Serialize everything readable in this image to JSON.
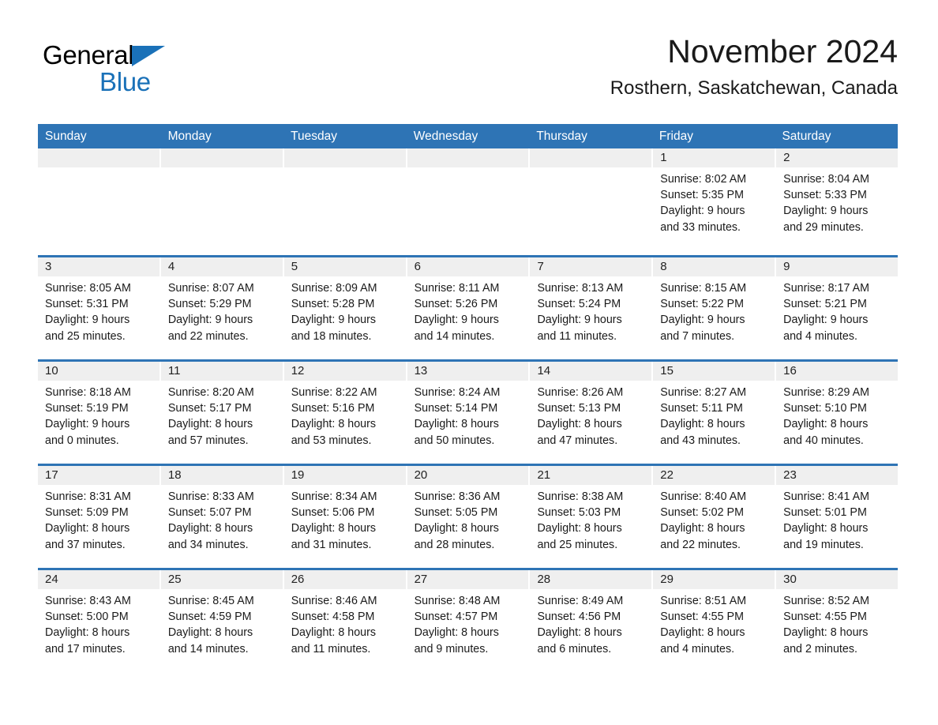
{
  "brand": {
    "name_part1": "General",
    "name_part2": "Blue"
  },
  "header": {
    "month_title": "November 2024",
    "location": "Rosthern, Saskatchewan, Canada"
  },
  "colors": {
    "header_blue": "#2e74b5",
    "logo_blue": "#1a71b8",
    "day_band_gray": "#efefef"
  },
  "calendar": {
    "weekdays": [
      "Sunday",
      "Monday",
      "Tuesday",
      "Wednesday",
      "Thursday",
      "Friday",
      "Saturday"
    ],
    "weeks": [
      [
        {
          "day": "",
          "empty": true
        },
        {
          "day": "",
          "empty": true
        },
        {
          "day": "",
          "empty": true
        },
        {
          "day": "",
          "empty": true
        },
        {
          "day": "",
          "empty": true
        },
        {
          "day": "1",
          "sunrise": "Sunrise: 8:02 AM",
          "sunset": "Sunset: 5:35 PM",
          "daylight_line1": "Daylight: 9 hours",
          "daylight_line2": "and 33 minutes."
        },
        {
          "day": "2",
          "sunrise": "Sunrise: 8:04 AM",
          "sunset": "Sunset: 5:33 PM",
          "daylight_line1": "Daylight: 9 hours",
          "daylight_line2": "and 29 minutes."
        }
      ],
      [
        {
          "day": "3",
          "sunrise": "Sunrise: 8:05 AM",
          "sunset": "Sunset: 5:31 PM",
          "daylight_line1": "Daylight: 9 hours",
          "daylight_line2": "and 25 minutes."
        },
        {
          "day": "4",
          "sunrise": "Sunrise: 8:07 AM",
          "sunset": "Sunset: 5:29 PM",
          "daylight_line1": "Daylight: 9 hours",
          "daylight_line2": "and 22 minutes."
        },
        {
          "day": "5",
          "sunrise": "Sunrise: 8:09 AM",
          "sunset": "Sunset: 5:28 PM",
          "daylight_line1": "Daylight: 9 hours",
          "daylight_line2": "and 18 minutes."
        },
        {
          "day": "6",
          "sunrise": "Sunrise: 8:11 AM",
          "sunset": "Sunset: 5:26 PM",
          "daylight_line1": "Daylight: 9 hours",
          "daylight_line2": "and 14 minutes."
        },
        {
          "day": "7",
          "sunrise": "Sunrise: 8:13 AM",
          "sunset": "Sunset: 5:24 PM",
          "daylight_line1": "Daylight: 9 hours",
          "daylight_line2": "and 11 minutes."
        },
        {
          "day": "8",
          "sunrise": "Sunrise: 8:15 AM",
          "sunset": "Sunset: 5:22 PM",
          "daylight_line1": "Daylight: 9 hours",
          "daylight_line2": "and 7 minutes."
        },
        {
          "day": "9",
          "sunrise": "Sunrise: 8:17 AM",
          "sunset": "Sunset: 5:21 PM",
          "daylight_line1": "Daylight: 9 hours",
          "daylight_line2": "and 4 minutes."
        }
      ],
      [
        {
          "day": "10",
          "sunrise": "Sunrise: 8:18 AM",
          "sunset": "Sunset: 5:19 PM",
          "daylight_line1": "Daylight: 9 hours",
          "daylight_line2": "and 0 minutes."
        },
        {
          "day": "11",
          "sunrise": "Sunrise: 8:20 AM",
          "sunset": "Sunset: 5:17 PM",
          "daylight_line1": "Daylight: 8 hours",
          "daylight_line2": "and 57 minutes."
        },
        {
          "day": "12",
          "sunrise": "Sunrise: 8:22 AM",
          "sunset": "Sunset: 5:16 PM",
          "daylight_line1": "Daylight: 8 hours",
          "daylight_line2": "and 53 minutes."
        },
        {
          "day": "13",
          "sunrise": "Sunrise: 8:24 AM",
          "sunset": "Sunset: 5:14 PM",
          "daylight_line1": "Daylight: 8 hours",
          "daylight_line2": "and 50 minutes."
        },
        {
          "day": "14",
          "sunrise": "Sunrise: 8:26 AM",
          "sunset": "Sunset: 5:13 PM",
          "daylight_line1": "Daylight: 8 hours",
          "daylight_line2": "and 47 minutes."
        },
        {
          "day": "15",
          "sunrise": "Sunrise: 8:27 AM",
          "sunset": "Sunset: 5:11 PM",
          "daylight_line1": "Daylight: 8 hours",
          "daylight_line2": "and 43 minutes."
        },
        {
          "day": "16",
          "sunrise": "Sunrise: 8:29 AM",
          "sunset": "Sunset: 5:10 PM",
          "daylight_line1": "Daylight: 8 hours",
          "daylight_line2": "and 40 minutes."
        }
      ],
      [
        {
          "day": "17",
          "sunrise": "Sunrise: 8:31 AM",
          "sunset": "Sunset: 5:09 PM",
          "daylight_line1": "Daylight: 8 hours",
          "daylight_line2": "and 37 minutes."
        },
        {
          "day": "18",
          "sunrise": "Sunrise: 8:33 AM",
          "sunset": "Sunset: 5:07 PM",
          "daylight_line1": "Daylight: 8 hours",
          "daylight_line2": "and 34 minutes."
        },
        {
          "day": "19",
          "sunrise": "Sunrise: 8:34 AM",
          "sunset": "Sunset: 5:06 PM",
          "daylight_line1": "Daylight: 8 hours",
          "daylight_line2": "and 31 minutes."
        },
        {
          "day": "20",
          "sunrise": "Sunrise: 8:36 AM",
          "sunset": "Sunset: 5:05 PM",
          "daylight_line1": "Daylight: 8 hours",
          "daylight_line2": "and 28 minutes."
        },
        {
          "day": "21",
          "sunrise": "Sunrise: 8:38 AM",
          "sunset": "Sunset: 5:03 PM",
          "daylight_line1": "Daylight: 8 hours",
          "daylight_line2": "and 25 minutes."
        },
        {
          "day": "22",
          "sunrise": "Sunrise: 8:40 AM",
          "sunset": "Sunset: 5:02 PM",
          "daylight_line1": "Daylight: 8 hours",
          "daylight_line2": "and 22 minutes."
        },
        {
          "day": "23",
          "sunrise": "Sunrise: 8:41 AM",
          "sunset": "Sunset: 5:01 PM",
          "daylight_line1": "Daylight: 8 hours",
          "daylight_line2": "and 19 minutes."
        }
      ],
      [
        {
          "day": "24",
          "sunrise": "Sunrise: 8:43 AM",
          "sunset": "Sunset: 5:00 PM",
          "daylight_line1": "Daylight: 8 hours",
          "daylight_line2": "and 17 minutes."
        },
        {
          "day": "25",
          "sunrise": "Sunrise: 8:45 AM",
          "sunset": "Sunset: 4:59 PM",
          "daylight_line1": "Daylight: 8 hours",
          "daylight_line2": "and 14 minutes."
        },
        {
          "day": "26",
          "sunrise": "Sunrise: 8:46 AM",
          "sunset": "Sunset: 4:58 PM",
          "daylight_line1": "Daylight: 8 hours",
          "daylight_line2": "and 11 minutes."
        },
        {
          "day": "27",
          "sunrise": "Sunrise: 8:48 AM",
          "sunset": "Sunset: 4:57 PM",
          "daylight_line1": "Daylight: 8 hours",
          "daylight_line2": "and 9 minutes."
        },
        {
          "day": "28",
          "sunrise": "Sunrise: 8:49 AM",
          "sunset": "Sunset: 4:56 PM",
          "daylight_line1": "Daylight: 8 hours",
          "daylight_line2": "and 6 minutes."
        },
        {
          "day": "29",
          "sunrise": "Sunrise: 8:51 AM",
          "sunset": "Sunset: 4:55 PM",
          "daylight_line1": "Daylight: 8 hours",
          "daylight_line2": "and 4 minutes."
        },
        {
          "day": "30",
          "sunrise": "Sunrise: 8:52 AM",
          "sunset": "Sunset: 4:55 PM",
          "daylight_line1": "Daylight: 8 hours",
          "daylight_line2": "and 2 minutes."
        }
      ]
    ]
  }
}
